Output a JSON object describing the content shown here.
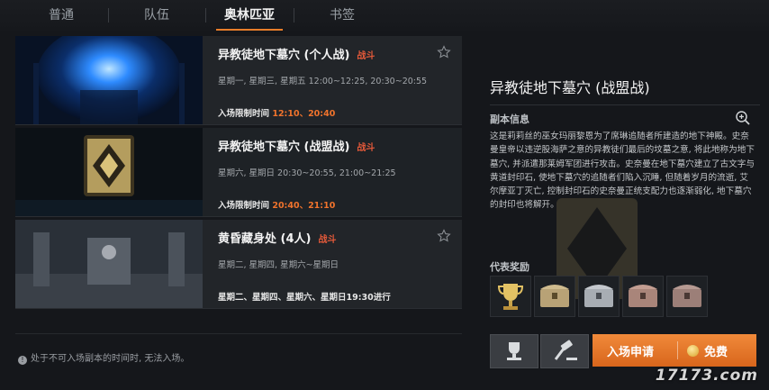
{
  "tabs": [
    {
      "label": "普通",
      "active": false
    },
    {
      "label": "队伍",
      "active": false
    },
    {
      "label": "奥林匹亚",
      "active": true
    },
    {
      "label": "书签",
      "active": false
    }
  ],
  "dungeons": [
    {
      "title": "异教徒地下墓穴 (个人战)",
      "type_label": "战斗",
      "schedule": "星期一, 星期三, 星期五  12:00~12:25, 20:30~20:55",
      "limit_label": "入场限制时间",
      "limit_value": "12:10、20:40"
    },
    {
      "title": "异教徒地下墓穴 (战盟战)",
      "type_label": "战斗",
      "schedule": "星期六, 星期日  20:30~20:55, 21:00~21:25",
      "limit_label": "入场限制时间",
      "limit_value": "20:40、21:10"
    },
    {
      "title": "黄昏藏身处 (4人)",
      "type_label": "战斗",
      "schedule": "星期二, 星期四, 星期六~星期日",
      "limit_label": "星期二、星期四、星期六、星期日19:30进行",
      "limit_value": ""
    }
  ],
  "notice": "处于不可入场副本的时间时, 无法入场。",
  "detail": {
    "title": "异教徒地下墓穴 (战盟战)",
    "info_label": "副本信息",
    "description": "这是莉莉丝的巫女玛丽黎恩为了席琳追随者所建造的地下神殿。史奈曼皇帝以违逆股海萨之意的异教徒们最后的坟墓之意, 将此地称为地下墓穴, 并派遣那莱姆军团进行攻击。史奈曼在地下墓穴建立了古文字与黄道封印石, 使地下墓穴的追随者们陷入沉睡, 但随着岁月的流逝, 艾尔摩亚丁灭亡, 控制封印石的史奈曼正统支配力也逐渐弱化, 地下墓穴的封印也将解开。",
    "rewards_label": "代表奖励",
    "rewards": [
      "trophy-icon",
      "chest-icon",
      "chest-icon",
      "chest-icon",
      "chest-icon"
    ],
    "enter_label": "入场申请",
    "cost_label": "免费"
  },
  "watermark": "17173.com"
}
